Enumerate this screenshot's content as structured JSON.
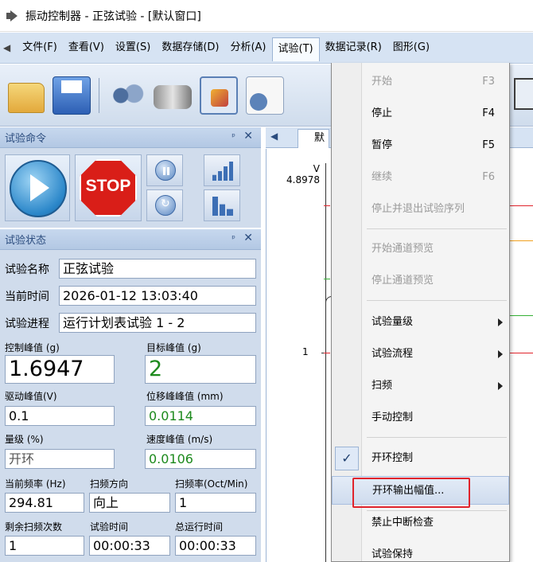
{
  "window": {
    "title": "振动控制器 - 正弦试验 - [默认窗口]"
  },
  "menubar": {
    "glyph": "◀",
    "items": [
      "文件(F)",
      "查看(V)",
      "设置(S)",
      "数据存储(D)",
      "分析(A)",
      "试验(T)",
      "数据记录(R)",
      "图形(G)"
    ],
    "active_index": 5
  },
  "panels": {
    "command": {
      "title": "试验命令",
      "stop_label": "STOP"
    },
    "status": {
      "title": "试验状态",
      "pin": "ᵖ",
      "close": "✕"
    }
  },
  "status": {
    "test_name": {
      "label": "试验名称",
      "value": "正弦试验"
    },
    "current_time": {
      "label": "当前时间",
      "value": "2026-01-12 13:03:40"
    },
    "progress": {
      "label": "试验进程",
      "value": "运行计划表试验 1 - 2"
    },
    "control_peak": {
      "label": "控制峰值 (g)",
      "value": "1.6947"
    },
    "target_peak": {
      "label": "目标峰值 (g)",
      "value": "2"
    },
    "drive_peak": {
      "label": "驱动峰值(V)",
      "value": "0.1"
    },
    "disp_peak": {
      "label": "位移峰峰值 (mm)",
      "value": "0.0114"
    },
    "level": {
      "label": "量级 (%)",
      "value": "开环"
    },
    "velocity_peak": {
      "label": "速度峰值 (m/s)",
      "value": "0.0106"
    },
    "current_freq": {
      "label": "当前频率 (Hz)",
      "value": "294.81"
    },
    "sweep_dir": {
      "label": "扫频方向",
      "value": "向上"
    },
    "sweep_rate": {
      "label": "扫频率(Oct/Min)",
      "value": "1"
    },
    "remaining_sweeps": {
      "label": "剩余扫频次数",
      "value": "1"
    },
    "test_time": {
      "label": "试验时间",
      "value": "00:00:33"
    },
    "total_time": {
      "label": "总运行时间",
      "value": "00:00:33"
    }
  },
  "plot": {
    "tab_label": "默",
    "y_unit": "V",
    "y_top": "4.8978",
    "y_mid": "1",
    "colors": {
      "red": "#e0242c",
      "orange": "#f0a020",
      "green": "#35b035"
    }
  },
  "dropdown": {
    "items": [
      {
        "label": "开始",
        "key": "F3",
        "disabled": true
      },
      {
        "label": "停止",
        "key": "F4",
        "disabled": false
      },
      {
        "label": "暂停",
        "key": "F5",
        "disabled": false
      },
      {
        "label": "继续",
        "key": "F6",
        "disabled": true
      },
      {
        "label": "停止并退出试验序列",
        "key": "",
        "disabled": true
      },
      {
        "label": "开始通道预览",
        "key": "",
        "disabled": true
      },
      {
        "label": "停止通道预览",
        "key": "",
        "disabled": true
      },
      {
        "label": "试验量级",
        "key": "",
        "disabled": false,
        "submenu": true
      },
      {
        "label": "试验流程",
        "key": "",
        "disabled": false,
        "submenu": true
      },
      {
        "label": "扫频",
        "key": "",
        "disabled": false,
        "submenu": true
      },
      {
        "label": "手动控制",
        "key": "",
        "disabled": false
      },
      {
        "label": "开环控制",
        "key": "",
        "disabled": false,
        "checked": true
      },
      {
        "label": "开环输出幅值...",
        "key": "",
        "disabled": false,
        "highlighted": true
      },
      {
        "label": "禁止中断检查",
        "key": "",
        "disabled": false
      },
      {
        "label": "试验保持",
        "key": "",
        "disabled": false
      }
    ],
    "check_glyph": "✓"
  }
}
